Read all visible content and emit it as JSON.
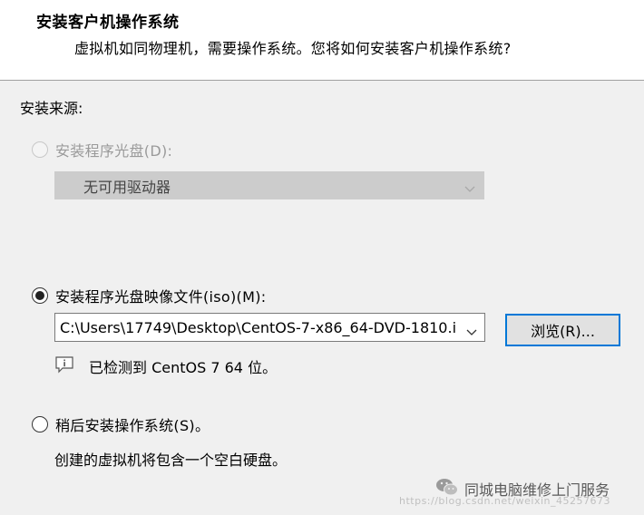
{
  "header": {
    "title": "安装客户机操作系统",
    "subtitle": "虚拟机如同物理机，需要操作系统。您将如何安装客户机操作系统?"
  },
  "install_source": {
    "label": "安装来源:",
    "disc_option": {
      "label": "安装程序光盘(D):",
      "selected": false,
      "enabled": false,
      "drive_value": "无可用驱动器"
    },
    "iso_option": {
      "label": "安装程序光盘映像文件(iso)(M):",
      "selected": true,
      "path_value": "C:\\Users\\17749\\Desktop\\CentOS-7-x86_64-DVD-1810.i",
      "browse_label": "浏览(R)...",
      "detected_text": "已检测到 CentOS 7 64 位。",
      "info_icon": "comment-info-icon"
    },
    "later_option": {
      "label": "稍后安装操作系统(S)。",
      "selected": false,
      "note": "创建的虚拟机将包含一个空白硬盘。"
    }
  },
  "watermark": {
    "icon": "wechat-icon",
    "text": "同城电脑维修上门服务",
    "url": "https://blog.csdn.net/weixin_45257673"
  },
  "colors": {
    "header_bg": "#ffffff",
    "body_bg": "#f0f0f0",
    "focus_border": "#0078d7",
    "disabled_text": "#9a9a9a"
  }
}
